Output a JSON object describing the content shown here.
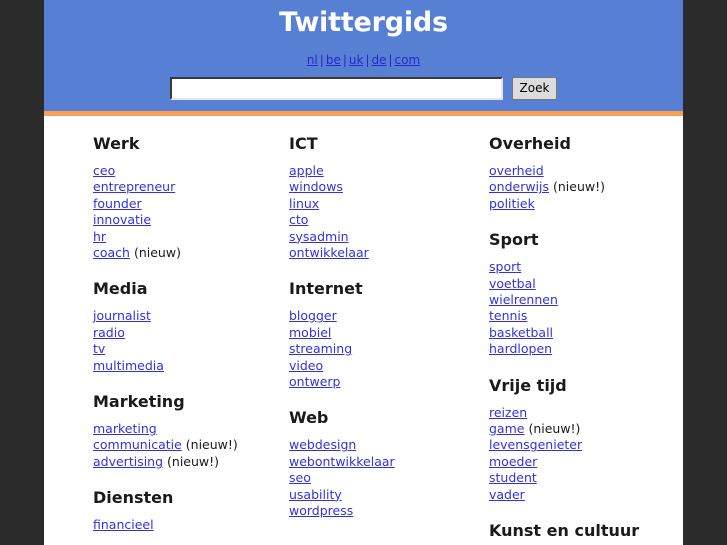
{
  "header": {
    "title": "Twittergids",
    "lang_links": [
      "nl",
      "be",
      "uk",
      "de",
      "com"
    ],
    "lang_separator": "|",
    "search": {
      "value": "",
      "placeholder": "",
      "button_label": "Zoek"
    },
    "colors": {
      "header_background": "#5780d5",
      "accent_stripe": "#f9a055",
      "title_text": "#ffffff",
      "link": "#3232e0"
    }
  },
  "directory": {
    "columns": [
      {
        "name": "column-left",
        "categories": [
          {
            "heading": "Werk",
            "links": [
              {
                "label": "ceo",
                "note": ""
              },
              {
                "label": "entrepreneur",
                "note": ""
              },
              {
                "label": "founder",
                "note": ""
              },
              {
                "label": "innovatie",
                "note": ""
              },
              {
                "label": "hr",
                "note": ""
              },
              {
                "label": "coach",
                "note": " (nieuw)"
              }
            ]
          },
          {
            "heading": "Media",
            "links": [
              {
                "label": "journalist",
                "note": ""
              },
              {
                "label": "radio",
                "note": ""
              },
              {
                "label": "tv",
                "note": ""
              },
              {
                "label": "multimedia",
                "note": ""
              }
            ]
          },
          {
            "heading": "Marketing",
            "links": [
              {
                "label": "marketing",
                "note": ""
              },
              {
                "label": "communicatie",
                "note": " (nieuw!)"
              },
              {
                "label": "advertising",
                "note": " (nieuw!)"
              }
            ]
          },
          {
            "heading": "Diensten",
            "links": [
              {
                "label": "financieel",
                "note": ""
              }
            ]
          }
        ]
      },
      {
        "name": "column-middle",
        "categories": [
          {
            "heading": "ICT",
            "links": [
              {
                "label": "apple",
                "note": ""
              },
              {
                "label": "windows",
                "note": ""
              },
              {
                "label": "linux",
                "note": ""
              },
              {
                "label": "cto",
                "note": ""
              },
              {
                "label": "sysadmin",
                "note": ""
              },
              {
                "label": "ontwikkelaar",
                "note": ""
              }
            ]
          },
          {
            "heading": "Internet",
            "links": [
              {
                "label": "blogger",
                "note": ""
              },
              {
                "label": "mobiel",
                "note": ""
              },
              {
                "label": "streaming",
                "note": ""
              },
              {
                "label": "video",
                "note": ""
              },
              {
                "label": "ontwerp",
                "note": ""
              }
            ]
          },
          {
            "heading": "Web",
            "links": [
              {
                "label": "webdesign",
                "note": ""
              },
              {
                "label": "webontwikkelaar",
                "note": ""
              },
              {
                "label": "seo",
                "note": ""
              },
              {
                "label": "usability",
                "note": ""
              },
              {
                "label": "wordpress",
                "note": ""
              }
            ]
          }
        ]
      },
      {
        "name": "column-right",
        "categories": [
          {
            "heading": "Overheid",
            "links": [
              {
                "label": "overheid",
                "note": ""
              },
              {
                "label": "onderwijs",
                "note": " (nieuw!)"
              },
              {
                "label": "politiek",
                "note": ""
              }
            ]
          },
          {
            "heading": "Sport",
            "links": [
              {
                "label": "sport",
                "note": ""
              },
              {
                "label": "voetbal",
                "note": ""
              },
              {
                "label": "wielrennen",
                "note": ""
              },
              {
                "label": "tennis",
                "note": ""
              },
              {
                "label": "basketball",
                "note": ""
              },
              {
                "label": "hardlopen",
                "note": ""
              }
            ]
          },
          {
            "heading": "Vrije tijd",
            "links": [
              {
                "label": "reizen",
                "note": ""
              },
              {
                "label": "game",
                "note": " (nieuw!)"
              },
              {
                "label": "levensgenieter",
                "note": ""
              },
              {
                "label": "moeder",
                "note": ""
              },
              {
                "label": "student",
                "note": ""
              },
              {
                "label": "vader",
                "note": ""
              }
            ]
          },
          {
            "heading": "Kunst en cultuur",
            "links": []
          }
        ]
      }
    ]
  }
}
